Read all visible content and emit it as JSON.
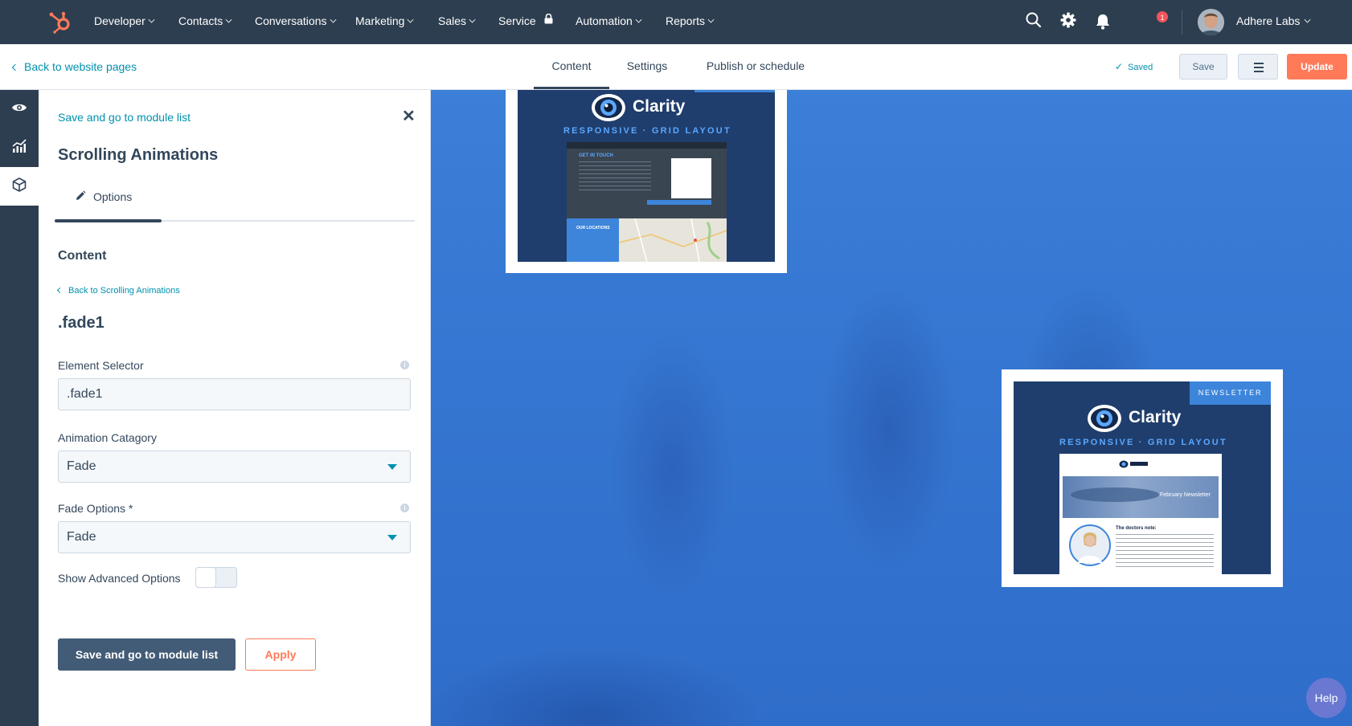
{
  "topnav": {
    "items": [
      {
        "label": "Developer"
      },
      {
        "label": "Contacts"
      },
      {
        "label": "Conversations"
      },
      {
        "label": "Marketing"
      },
      {
        "label": "Sales"
      },
      {
        "label": "Service"
      },
      {
        "label": "Automation"
      },
      {
        "label": "Reports"
      }
    ],
    "notification_count": "1",
    "account_name": "Adhere Labs"
  },
  "subheader": {
    "back_label": "Back to website pages",
    "tabs": [
      {
        "label": "Content"
      },
      {
        "label": "Settings"
      },
      {
        "label": "Publish or schedule"
      }
    ],
    "status": "Saved",
    "save_label": "Save",
    "update_label": "Update"
  },
  "panel": {
    "top_link": "Save and go to module list",
    "title": "Scrolling Animations",
    "tab_label": "Options",
    "section_title": "Content",
    "back_link": "Back to Scrolling Animations",
    "subtitle": ".fade1",
    "fields": {
      "element_selector_label": "Element Selector",
      "element_selector_value": ".fade1",
      "animation_category_label": "Animation Catagory",
      "animation_category_value": "Fade",
      "fade_options_label": "Fade Options *",
      "fade_options_value": "Fade",
      "advanced_label": "Show Advanced Options",
      "advanced_enabled": false
    },
    "primary_button": "Save and go to module list",
    "apply_button": "Apply"
  },
  "preview": {
    "card1": {
      "brand": "Clarity",
      "tagline": "RESPONSIVE · GRID LAYOUT",
      "mock_heading": "GET IN TOUCH",
      "mock_sub": "OUR LOCATIONS"
    },
    "card2": {
      "badge": "NEWSLETTER",
      "brand": "Clarity",
      "tagline": "RESPONSIVE · GRID LAYOUT",
      "banner": "February Newsletter",
      "note_title": "The doctors note:"
    }
  },
  "help_label": "Help",
  "colors": {
    "nav_bg": "#2d3e50",
    "accent": "#0091ae",
    "primary_orange": "#ff7a59",
    "preview_blue": "#3577d2"
  }
}
